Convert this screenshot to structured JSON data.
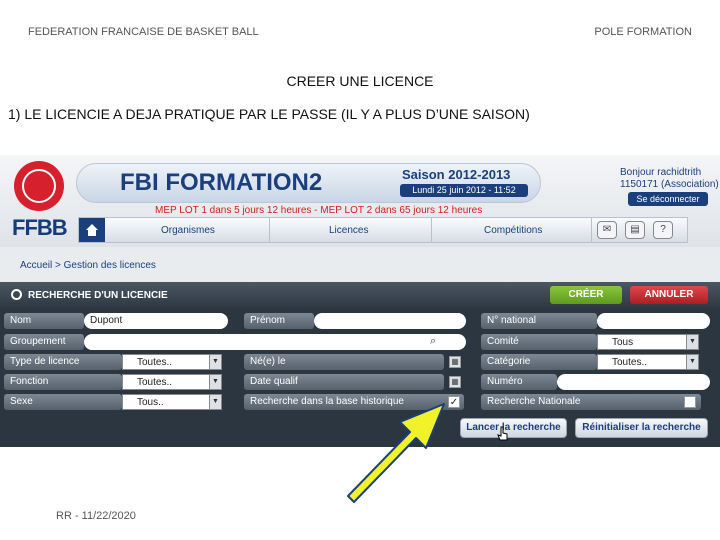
{
  "slide": {
    "header_left": "FEDERATION FRANCAISE DE BASKET BALL",
    "header_right": "POLE FORMATION",
    "title": "CREER UNE LICENCE",
    "subtitle": "1) LE LICENCIE A DEJA PRATIQUE PAR LE PASSE (IL Y A PLUS D’UNE SAISON)",
    "footer": "RR - 11/22/2020"
  },
  "app": {
    "logo_text": "FFBB",
    "title": "FBI FORMATION2",
    "season": "Saison 2012-2013",
    "date": "Lundi 25 juin 2012 - 11:52",
    "mep_notice": "MEP LOT 1 dans 5 jours 12 heures - MEP LOT 2 dans 65 jours 12 heures",
    "user_greeting": "Bonjour rachidtrith",
    "user_org": "1150171 (Association)",
    "logout_label": "Se déconnecter"
  },
  "nav": {
    "items": [
      "Organismes",
      "Licences",
      "Compétitions"
    ],
    "tool_icons": [
      "mail-icon",
      "book-icon",
      "help-icon"
    ]
  },
  "breadcrumb": "Accueil > Gestion des licences",
  "panel": {
    "title": "RECHERCHE D'UN LICENCIE",
    "create_label": "CRÉER",
    "cancel_label": "ANNULER"
  },
  "form": {
    "nom_label": "Nom",
    "nom_value": "Dupont",
    "prenom_label": "Prénom",
    "prenom_value": "",
    "numero_national_label": "N° national",
    "numero_national_value": "",
    "groupement_label": "Groupement",
    "groupement_value": "",
    "comite_label": "Comité",
    "comite_value": "Tous",
    "type_licence_label": "Type de licence",
    "type_licence_value": "Toutes..",
    "ne_le_label": "Né(e) le",
    "categorie_label": "Catégorie",
    "categorie_value": "Toutes..",
    "fonction_label": "Fonction",
    "fonction_value": "Toutes..",
    "date_qualif_label": "Date qualif",
    "numero_label": "Numéro",
    "numero_value": "",
    "sexe_label": "Sexe",
    "sexe_value": "Tous..",
    "historique_label": "Recherche dans la base historique",
    "historique_checked": "✓",
    "nationale_label": "Recherche Nationale",
    "search_button": "Lancer la recherche",
    "reset_button": "Réinitialiser la recherche"
  },
  "colors": {
    "brand_blue": "#1b3f7c",
    "brand_red": "#d6202d",
    "arrow_fill": "#f2f22a"
  }
}
